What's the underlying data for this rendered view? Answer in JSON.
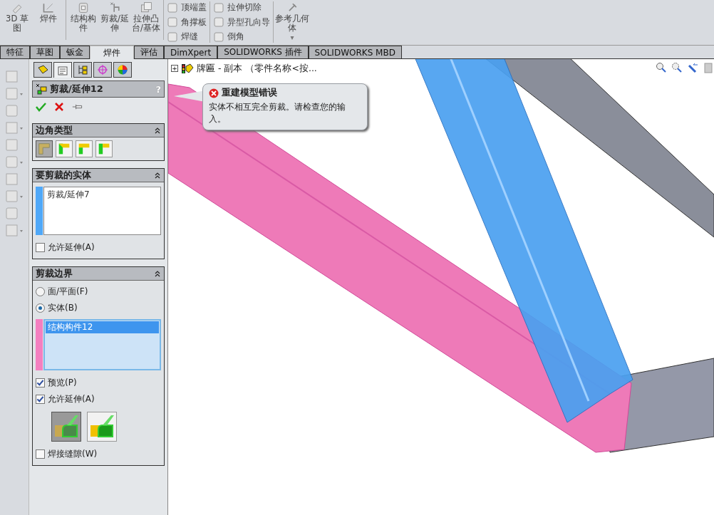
{
  "toolbar": {
    "large_buttons": [
      {
        "label": "3D 草图",
        "kind": "sketch3d"
      },
      {
        "label": "焊件",
        "kind": "weldment"
      },
      {
        "label": "结构构件",
        "kind": "structural"
      },
      {
        "label": "剪裁/延伸",
        "kind": "trim"
      },
      {
        "label": "拉伸凸台/基体",
        "kind": "extrude"
      }
    ],
    "small_columns": [
      [
        "顶端盖",
        "角撑板",
        "焊缝"
      ],
      [
        "拉伸切除",
        "异型孔向导",
        "倒角"
      ]
    ],
    "reference": {
      "label": "参考几何体",
      "caret": "▾"
    }
  },
  "tabs": [
    {
      "label": "特征",
      "selected": false
    },
    {
      "label": "草图",
      "selected": false
    },
    {
      "label": "钣金",
      "selected": false
    },
    {
      "label": "焊件",
      "selected": true
    },
    {
      "label": "评估",
      "selected": false
    },
    {
      "label": "DimXpert",
      "selected": false
    },
    {
      "label": "SOLIDWORKS 插件",
      "selected": false
    },
    {
      "label": "SOLIDWORKS MBD",
      "selected": false
    }
  ],
  "property_manager": {
    "title": "剪裁/延伸12",
    "help": "?",
    "corner_type": {
      "title": "边角类型",
      "options": [
        {
          "selected": true
        },
        {
          "selected": false
        },
        {
          "selected": false
        },
        {
          "selected": false
        }
      ]
    },
    "bodies_to_trim": {
      "title": "要剪裁的实体",
      "items": [
        "剪裁/延伸7"
      ],
      "allow_extension": {
        "label": "允许延伸(A)",
        "checked": false
      }
    },
    "trim_boundary": {
      "title": "剪裁边界",
      "radios": [
        {
          "label": "面/平面(F)",
          "selected": false
        },
        {
          "label": "实体(B)",
          "selected": true
        }
      ],
      "items": [
        {
          "label": "结构构件12",
          "selected": true
        }
      ],
      "checkboxes": [
        {
          "label": "预览(P)",
          "checked": true
        },
        {
          "label": "允许延伸(A)",
          "checked": true
        }
      ],
      "trim_options": [
        {
          "selected": true
        },
        {
          "selected": false
        }
      ],
      "weld_gap": {
        "label": "焊接缝隙(W)",
        "checked": false
      }
    }
  },
  "tree": {
    "expander": "+",
    "label": "牌匾 - 副本 （零件名称<按..."
  },
  "error_balloon": {
    "title": "重建模型错误",
    "message": "实体不相互完全剪裁。请检查您的输入。"
  }
}
